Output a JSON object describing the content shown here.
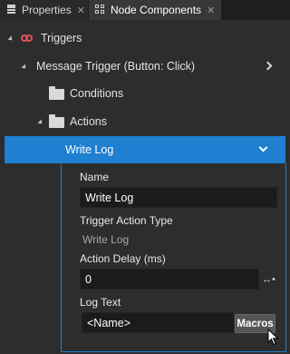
{
  "tabs": [
    {
      "label": "Properties",
      "active": false
    },
    {
      "label": "Node Components",
      "active": true
    }
  ],
  "tree": {
    "triggers_label": "Triggers",
    "message_trigger_label": "Message Trigger (Button: Click)",
    "conditions_label": "Conditions",
    "actions_label": "Actions",
    "write_log_label": "Write Log"
  },
  "details": {
    "name_label": "Name",
    "name_value": "Write Log",
    "type_label": "Trigger Action Type",
    "type_value": "Write Log",
    "delay_label": "Action Delay (ms)",
    "delay_value": "0",
    "log_text_label": "Log Text",
    "log_text_value": "<Name>",
    "macros_label": "Macros"
  },
  "colors": {
    "accent": "#1f7fd0",
    "trigger_icon": "#e0505a",
    "panel_bg": "#2d2d2d",
    "field_bg": "#1b1b1b"
  },
  "icons": [
    "list-icon",
    "node-components-icon",
    "close-icon",
    "expander-icon",
    "trigger-icon",
    "chevron-right-icon",
    "folder-icon",
    "chevron-down-icon",
    "drag-handle-icon",
    "cursor-icon"
  ]
}
